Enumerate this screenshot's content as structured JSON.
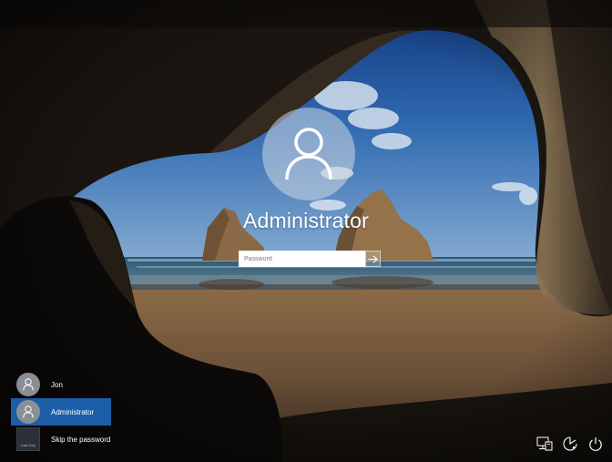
{
  "login": {
    "username": "Administrator",
    "password_placeholder": "Password",
    "user_icon": "user-silhouette-icon",
    "submit_icon": "arrow-right-icon"
  },
  "user_list": {
    "items": [
      {
        "name": "Jon",
        "avatar": "user-silhouette-icon",
        "selected": false
      },
      {
        "name": "Administrator",
        "avatar": "user-silhouette-icon",
        "selected": true
      },
      {
        "name": "Skip the password",
        "avatar": "tile-image",
        "avatar_caption": "Intel Key",
        "selected": false
      }
    ]
  },
  "system_icons": [
    "network-icon",
    "ease-of-access-icon",
    "power-icon"
  ],
  "colors": {
    "selected_user_bg": "#1c5ea8",
    "text": "#ffffff"
  }
}
